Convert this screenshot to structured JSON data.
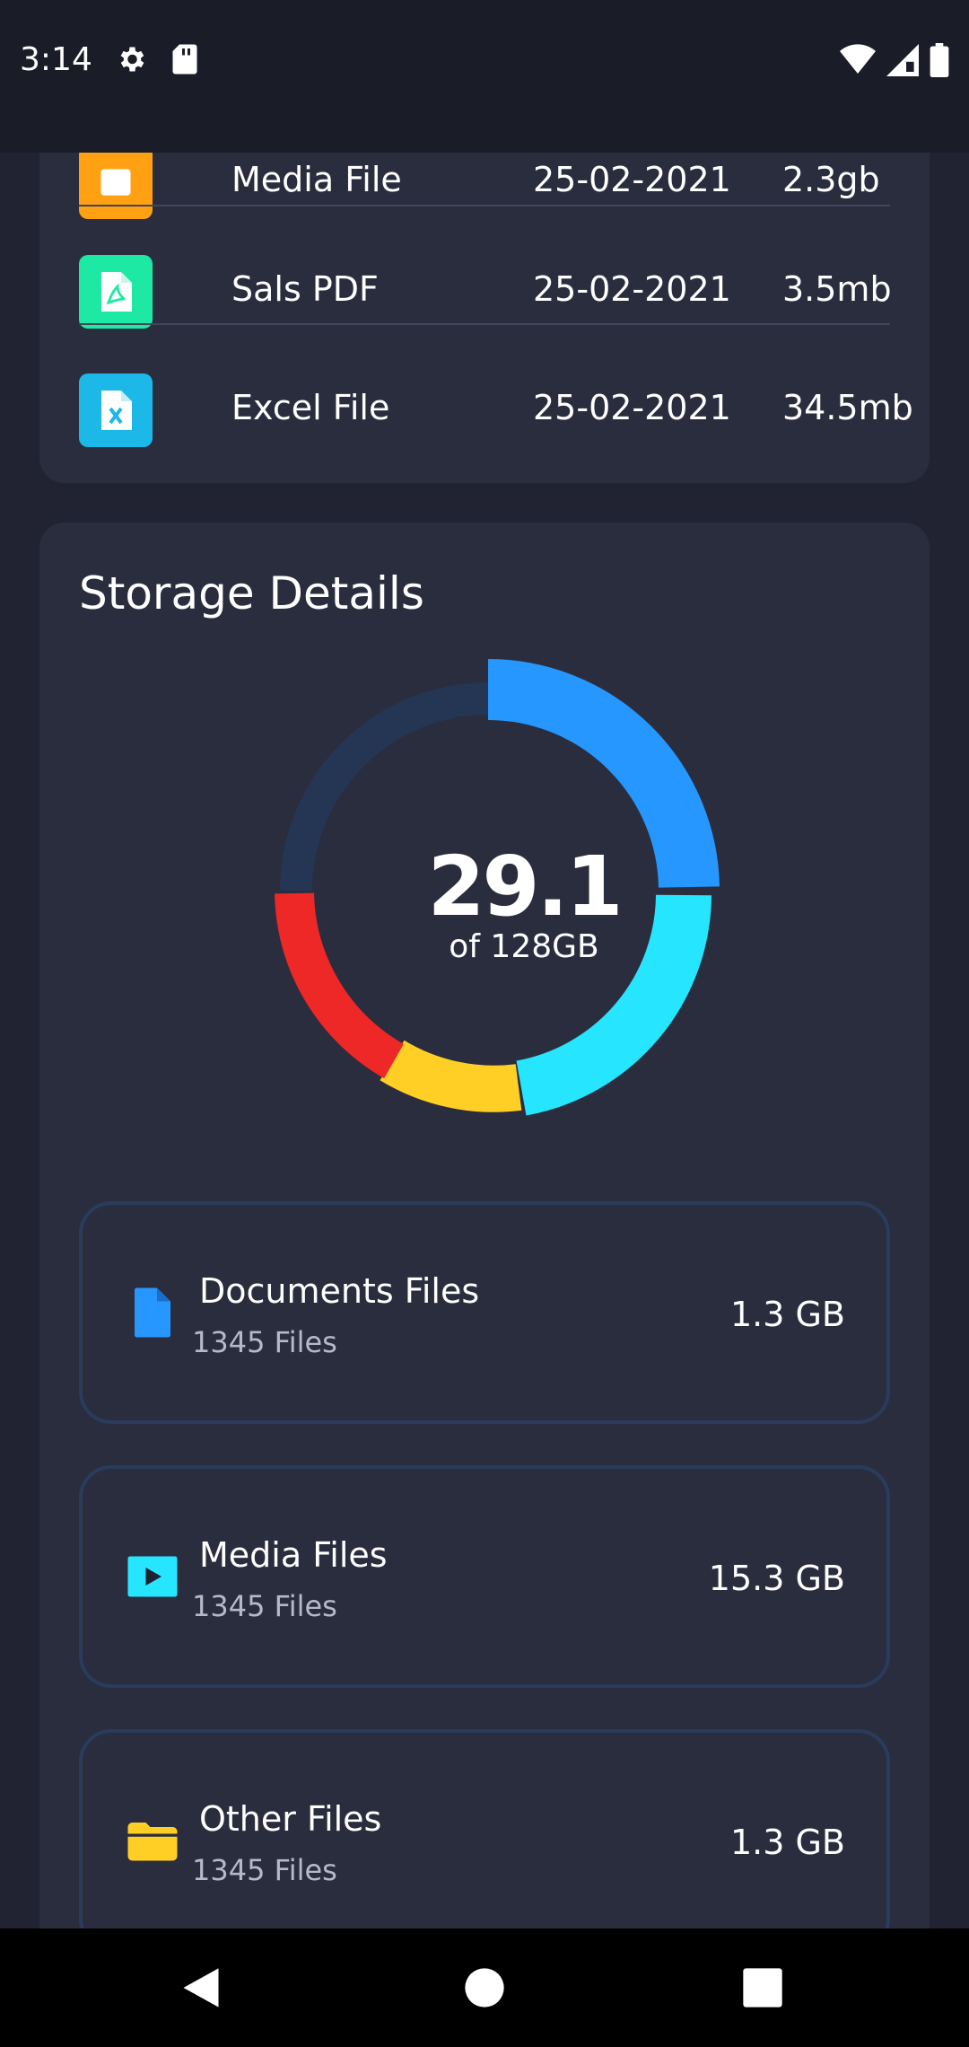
{
  "status_bar": {
    "time": "3:14",
    "icons_left": [
      "settings-icon",
      "sd-card-icon"
    ],
    "icons_right": [
      "wifi-icon",
      "cell-signal-icon",
      "battery-icon"
    ]
  },
  "recent_files": [
    {
      "name": "Media File",
      "date": "25-02-2021",
      "size": "2.3gb",
      "icon": "media-file-icon",
      "color": "#FFA113"
    },
    {
      "name": "Sals PDF",
      "date": "25-02-2021",
      "size": "3.5mb",
      "icon": "pdf-file-icon",
      "color": "#1DE9A4"
    },
    {
      "name": "Excel File",
      "date": "25-02-2021",
      "size": "34.5mb",
      "icon": "excel-file-icon",
      "color": "#1BB8E8"
    }
  ],
  "storage": {
    "title": "Storage Details",
    "used": "29.1",
    "of_total": "of 128GB",
    "segments": [
      {
        "color": "#2697FF",
        "value": 25
      },
      {
        "color": "#26E5FF",
        "value": 20
      },
      {
        "color": "#FFCF26",
        "value": 10
      },
      {
        "color": "#EE2727",
        "value": 15
      },
      {
        "color": "#253554",
        "value": 30
      }
    ],
    "items": [
      {
        "title": "Documents Files",
        "count": "1345 Files",
        "size": "1.3 GB",
        "icon": "document-icon",
        "color": "#2697FF"
      },
      {
        "title": "Media Files",
        "count": "1345 Files",
        "size": "15.3 GB",
        "icon": "media-play-icon",
        "color": "#26E5FF"
      },
      {
        "title": "Other Files",
        "count": "1345 Files",
        "size": "1.3 GB",
        "icon": "folder-icon",
        "color": "#FFCF26"
      }
    ]
  },
  "nav": {
    "buttons": [
      "back-icon",
      "home-icon",
      "recents-icon"
    ]
  }
}
